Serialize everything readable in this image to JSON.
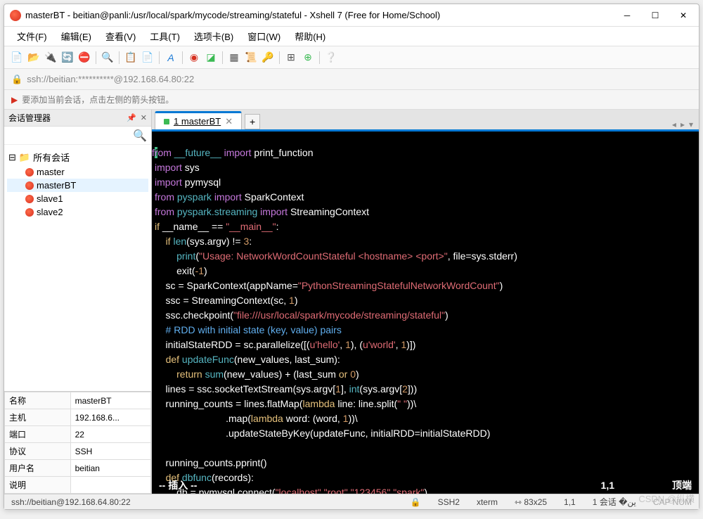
{
  "title": "masterBT - beitian@panli:/usr/local/spark/mycode/streaming/stateful - Xshell 7 (Free for Home/School)",
  "menu": [
    "文件(F)",
    "编辑(E)",
    "查看(V)",
    "工具(T)",
    "选项卡(B)",
    "窗口(W)",
    "帮助(H)"
  ],
  "address": "ssh://beitian:**********@192.168.64.80:22",
  "hint": "要添加当前会话，点击左侧的箭头按钮。",
  "sidebar": {
    "title": "会话管理器",
    "root": "所有会话",
    "sessions": [
      "master",
      "masterBT",
      "slave1",
      "slave2"
    ],
    "selected": "masterBT"
  },
  "props": {
    "名称": "masterBT",
    "主机": "192.168.6...",
    "端口": "22",
    "协议": "SSH",
    "用户名": "beitian",
    "说明": ""
  },
  "tab": {
    "num": "1",
    "name": "masterBT"
  },
  "code": {
    "l1": {
      "a": "from",
      "b": " __future__ ",
      "c": "import",
      "d": " print_function"
    },
    "l2": {
      "a": "import",
      "b": " sys"
    },
    "l3": {
      "a": "import",
      "b": " pymysql"
    },
    "l4": {
      "a": "from",
      "b": " pyspark ",
      "c": "import",
      "d": " SparkContext"
    },
    "l5": {
      "a": "from",
      "b": " pyspark.streaming ",
      "c": "import",
      "d": " StreamingContext"
    },
    "l6": {
      "a": "if",
      "b": " __name__ == ",
      "c": "\"__main__\"",
      "d": ":"
    },
    "l7": {
      "a": "    ",
      "b": "if",
      "c": " ",
      "d": "len",
      "e": "(sys.argv) != ",
      "f": "3",
      "g": ":"
    },
    "l8": {
      "a": "        ",
      "b": "print",
      "c": "(",
      "d": "\"Usage: NetworkWordCountStateful <hostname> <port>\"",
      "e": ", file=sys.stderr)"
    },
    "l9": {
      "a": "        exit(",
      "b": "-1",
      "c": ")"
    },
    "l10": {
      "a": "    sc = SparkContext(appName=",
      "b": "\"PythonStreamingStatefulNetworkWordCount\"",
      "c": ")"
    },
    "l11": {
      "a": "    ssc = StreamingContext(sc, ",
      "b": "1",
      "c": ")"
    },
    "l12": {
      "a": "    ssc.checkpoint(",
      "b": "\"file:///usr/local/spark/mycode/streaming/stateful\"",
      "c": ")"
    },
    "l13": "    # RDD with initial state (key, value) pairs",
    "l14": {
      "a": "    initialStateRDD = sc.parallelize([(",
      "b": "u'hello'",
      "c": ", ",
      "d": "1",
      "e": "), (",
      "f": "u'world'",
      "g": ", ",
      "h": "1",
      "i": ")])"
    },
    "l15": {
      "a": "    ",
      "b": "def",
      "c": " ",
      "d": "updateFunc",
      "e": "(new_values, last_sum):"
    },
    "l16": {
      "a": "        ",
      "b": "return",
      "c": " ",
      "d": "sum",
      "e": "(new_values) + (last_sum ",
      "f": "or",
      "g": " ",
      "h": "0",
      "i": ")"
    },
    "l17": {
      "a": "    lines = ssc.socketTextStream(sys.argv[",
      "b": "1",
      "c": "], ",
      "d": "int",
      "e": "(sys.argv[",
      "f": "2",
      "g": "]))"
    },
    "l18": {
      "a": "    running_counts = lines.flatMap(",
      "b": "lambda",
      "c": " line: line.split(",
      "d": "\" \"",
      "e": "))\\"
    },
    "l19": {
      "a": "                          .map(",
      "b": "lambda",
      "c": " word: (word, ",
      "d": "1",
      "e": "))\\"
    },
    "l20": "                          .updateStateByKey(updateFunc, initialRDD=initialStateRDD)",
    "l21": " ",
    "l22": "    running_counts.pprint()",
    "l23": {
      "a": "    ",
      "b": "def",
      "c": " ",
      "d": "dbfunc",
      "e": "(records):"
    },
    "l24": {
      "a": "        db = pymysql.connect(",
      "b": "\"localhost\"",
      "c": ",",
      "d": "\"root\"",
      "e": ",",
      "f": "\"123456\"",
      "g": ",",
      "h": "\"spark\"",
      "i": ")"
    }
  },
  "term_status": {
    "left": "-- 插入 --",
    "pos": "1,1",
    "right": "顶端"
  },
  "status": {
    "addr": "ssh://beitian@192.168.64.80:22",
    "proto": "SSH2",
    "term": "xterm",
    "size": "83x25",
    "cursor": "1,1",
    "sess": "1 会话",
    "caps": "CAP  NUM"
  },
  "watermark": "CSDN @纵横"
}
